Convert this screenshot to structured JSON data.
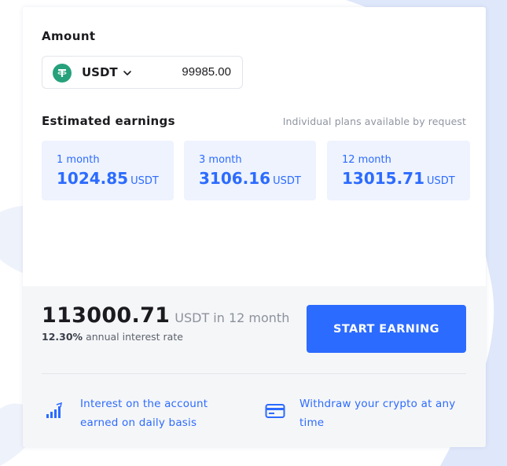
{
  "calculator": {
    "amount_label": "Amount",
    "currency": {
      "code": "USDT",
      "icon": "tether-icon",
      "brand_color": "#26a17b"
    },
    "amount_value": "99985.00",
    "estimated_label": "Estimated earnings",
    "plans_note": "Individual plans available by request",
    "tiles": [
      {
        "period": "1 month",
        "value": "1024.85",
        "unit": "USDT"
      },
      {
        "period": "3 month",
        "value": "3106.16",
        "unit": "USDT"
      },
      {
        "period": "12 month",
        "value": "13015.71",
        "unit": "USDT"
      }
    ],
    "summary": {
      "total": "113000.71",
      "total_suffix": "USDT in 12 month",
      "rate_value": "12.30%",
      "rate_text": "annual interest rate",
      "cta_label": "START EARNING"
    },
    "features": [
      {
        "icon": "bar-chart-icon",
        "line1": "Interest on the account",
        "line2": "earned on daily basis"
      },
      {
        "icon": "card-icon",
        "line1": "Withdraw your crypto at any",
        "line2": "time"
      }
    ]
  },
  "colors": {
    "accent": "#2c6bff",
    "tile_bg": "#eef3fe",
    "footer_bg": "#f5f6f8",
    "text_dark": "#1b1b1f",
    "muted": "#9095a1"
  }
}
